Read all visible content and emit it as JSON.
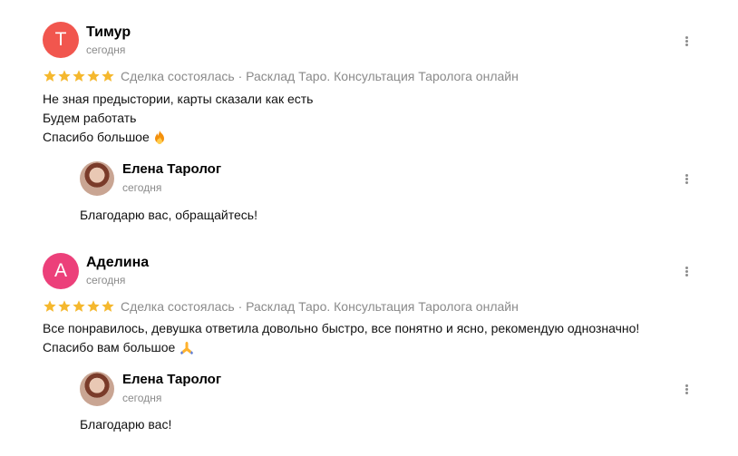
{
  "colors": {
    "avatar_t": "#f1564e",
    "avatar_a": "#ec407a",
    "star": "#f5b82e",
    "meta_text": "#8a8a8a"
  },
  "icons": [
    "star-icon",
    "more-vertical-icon",
    "fire-emoji-icon",
    "pray-emoji-icon"
  ],
  "reviews": [
    {
      "avatar_letter": "Т",
      "author": "Тимур",
      "date": "сегодня",
      "rating": 5,
      "meta": "Сделка состоялась · Расклад Таро. Консультация Таролога онлайн",
      "lines": [
        "Не зная предыстории, карты сказали как есть",
        "Будем работать",
        "Спасибо большое"
      ],
      "reply": {
        "author": "Елена Таролог",
        "date": "сегодня",
        "text": "Благодарю вас, обращайтесь!"
      }
    },
    {
      "avatar_letter": "А",
      "author": "Аделина",
      "date": "сегодня",
      "rating": 5,
      "meta": "Сделка состоялась · Расклад Таро. Консультация Таролога онлайн",
      "lines": [
        "Все понравилось, девушка ответила довольно быстро, все понятно и ясно, рекомендую однозначно!",
        "Спасибо вам большое"
      ],
      "reply": {
        "author": "Елена Таролог",
        "date": "сегодня",
        "text": "Благодарю вас!"
      }
    }
  ]
}
